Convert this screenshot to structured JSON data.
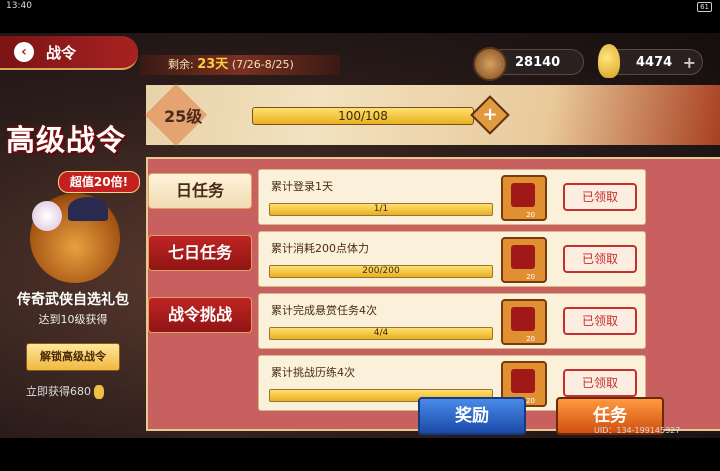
{
  "status": {
    "time": "13:40",
    "battery": "61"
  },
  "header": {
    "back_label": "战令",
    "remaining_label": "剩余:",
    "remaining_days": "23天",
    "remaining_range": "(7/26-8/25)"
  },
  "resources": {
    "coins": "28140",
    "gold": "4474"
  },
  "left_panel": {
    "title": "高级战令",
    "badge": "超值20倍!",
    "pack_name": "传奇武侠自选礼包",
    "pack_sub": "达到10级获得",
    "unlock_button": "解锁高级战令",
    "get_now": "立即获得680"
  },
  "level": {
    "label": "25级",
    "progress_text": "100/108",
    "progress": 0.926
  },
  "tabs": [
    {
      "label": "日任务",
      "active": true
    },
    {
      "label": "七日任务",
      "active": false
    },
    {
      "label": "战令挑战",
      "active": false
    }
  ],
  "tasks": [
    {
      "name": "累计登录1天",
      "progress_text": "1/1",
      "progress": 1,
      "reward_count": "20",
      "claim_label": "已领取"
    },
    {
      "name": "累计消耗200点体力",
      "progress_text": "200/200",
      "progress": 1,
      "reward_count": "20",
      "claim_label": "已领取"
    },
    {
      "name": "累计完成悬赏任务4次",
      "progress_text": "4/4",
      "progress": 1,
      "reward_count": "20",
      "claim_label": "已领取"
    },
    {
      "name": "累计挑战历练4次",
      "progress_text": "",
      "progress": 1,
      "reward_count": "20",
      "claim_label": "已领取"
    }
  ],
  "bottom": {
    "reward_button": "奖励",
    "task_button": "任务",
    "uid": "UID：134-199145327"
  }
}
